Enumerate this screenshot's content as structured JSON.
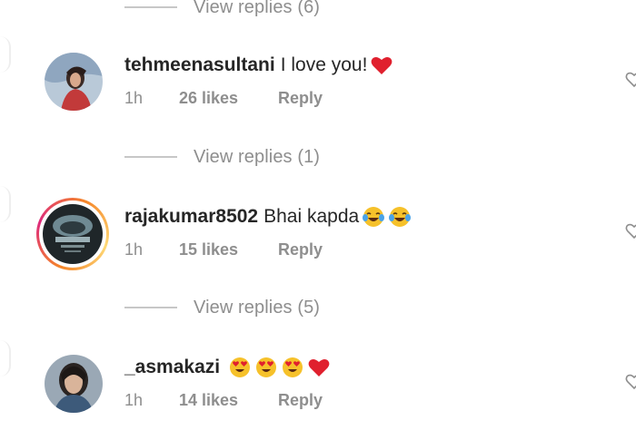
{
  "view_replies": [
    {
      "label": "View replies (6)"
    },
    {
      "label": "View replies (1)"
    },
    {
      "label": "View replies (5)"
    }
  ],
  "comments": [
    {
      "username": "tehmeenasultani",
      "text": "I love you!",
      "emojis": [
        "red-heart"
      ],
      "time": "1h",
      "likes": "26 likes",
      "reply": "Reply"
    },
    {
      "username": "rajakumar8502",
      "text": "Bhai kapda",
      "emojis": [
        "tears-of-joy",
        "tears-of-joy"
      ],
      "time": "1h",
      "likes": "15 likes",
      "reply": "Reply"
    },
    {
      "username": "_asmakazi",
      "text": "",
      "emojis": [
        "heart-eyes",
        "heart-eyes",
        "heart-eyes",
        "red-heart"
      ],
      "time": "1h",
      "likes": "14 likes",
      "reply": "Reply"
    }
  ],
  "colors": {
    "text": "#262626",
    "muted": "#8e8e8e",
    "heart": "#ed4956",
    "story_ring": "#dd2a7b"
  }
}
